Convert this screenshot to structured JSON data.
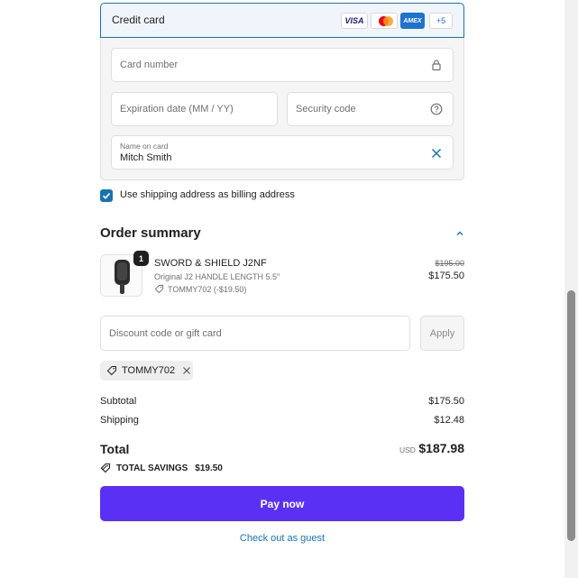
{
  "payment": {
    "method_label": "Credit card",
    "card_logos": {
      "visa": "VISA",
      "amex": "AMEX",
      "more": "+5"
    },
    "card_number_placeholder": "Card number",
    "expiration_placeholder": "Expiration date (MM / YY)",
    "security_code_placeholder": "Security code",
    "name_label": "Name on card",
    "name_value": "Mitch Smith",
    "billing_checkbox_label": "Use shipping address as billing address",
    "billing_checkbox_checked": true
  },
  "order_summary": {
    "title": "Order summary",
    "product": {
      "quantity": "1",
      "name": "SWORD & SHIELD J2NF",
      "variant": "Original J2 HANDLE LENGTH 5.5\"",
      "discount": "TOMMY702 (-$19.50)",
      "original_price": "$195.00",
      "price": "$175.50"
    },
    "discount_placeholder": "Discount code or gift card",
    "apply_label": "Apply",
    "applied_code": "TOMMY702",
    "subtotal_label": "Subtotal",
    "subtotal_value": "$175.50",
    "shipping_label": "Shipping",
    "shipping_value": "$12.48",
    "total_label": "Total",
    "total_currency": "USD",
    "total_value": "$187.98",
    "savings_label": "TOTAL SAVINGS",
    "savings_value": "$19.50"
  },
  "actions": {
    "pay_label": "Pay now",
    "guest_label": "Check out as guest"
  },
  "colors": {
    "accent": "#1773b0",
    "pay_button": "#5a31f4"
  }
}
